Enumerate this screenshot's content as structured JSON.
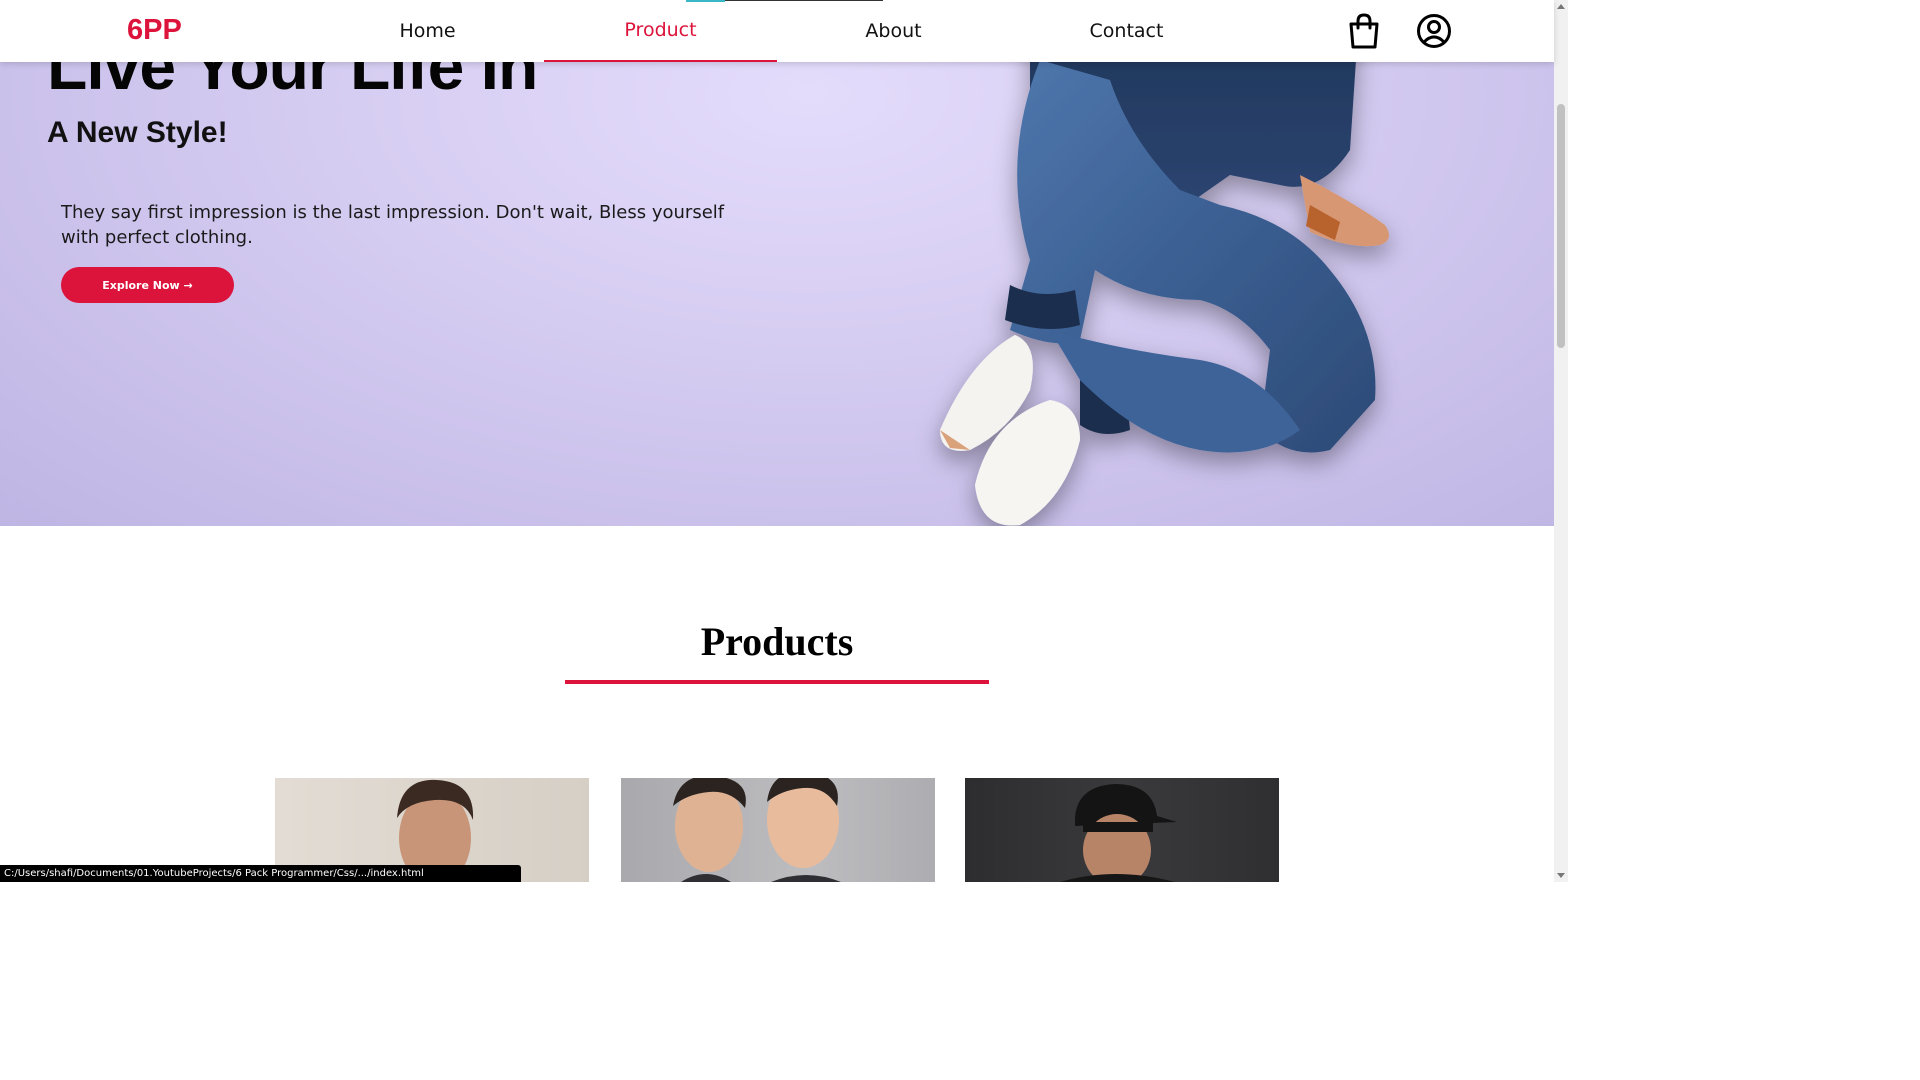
{
  "brand": {
    "logo": "6PP",
    "accent_color": "#dc143c"
  },
  "nav": {
    "items": [
      {
        "label": "Home"
      },
      {
        "label": "Product",
        "active": true
      },
      {
        "label": "About"
      },
      {
        "label": "Contact"
      }
    ],
    "icons": [
      "shopping-bag-icon",
      "user-account-icon"
    ]
  },
  "hero": {
    "heading": "Live Your Life In",
    "subheading": "A New Style!",
    "text": "They say first impression is the last impression. Don't wait, Bless yourself with perfect clothing.",
    "button_label": "Explore Now →"
  },
  "products": {
    "title": "Products",
    "cards": [
      {
        "image": "man-portrait-light-background"
      },
      {
        "image": "two-men-grey-background"
      },
      {
        "image": "man-black-cap-dark-background"
      }
    ]
  },
  "status_bar": {
    "url": "C:/Users/shafi/Documents/01.YoutubeProjects/6 Pack Programmer/Css/.../index.html"
  }
}
